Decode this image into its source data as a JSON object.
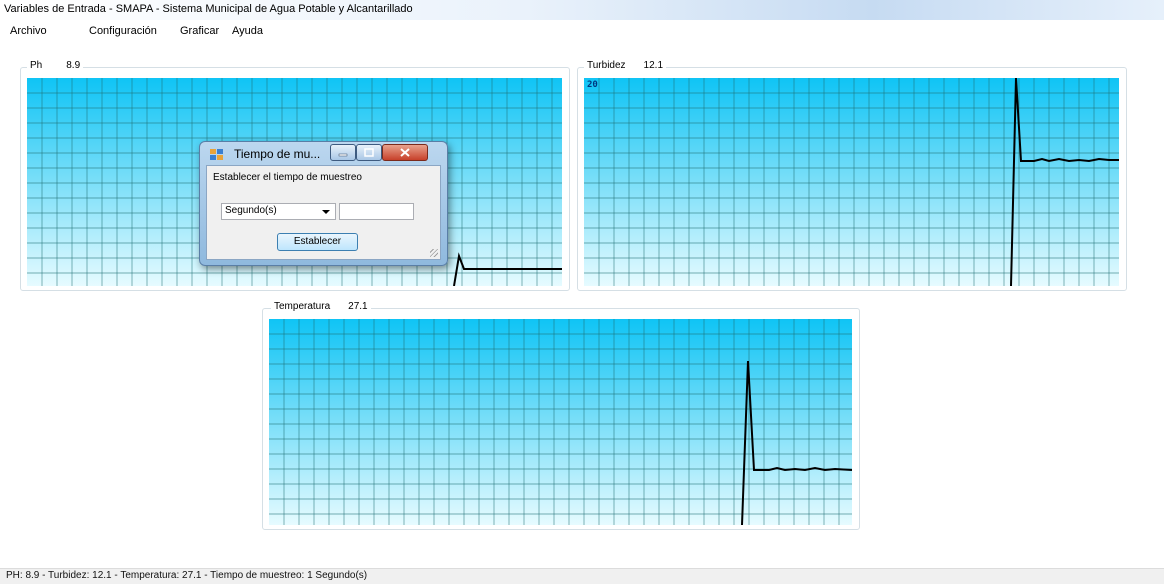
{
  "window": {
    "title": "Variables de Entrada - SMAPA - Sistema Municipal de Agua Potable y Alcantarillado"
  },
  "menu": [
    "Archivo",
    "Configuración",
    "Graficar",
    "Ayuda"
  ],
  "panels": {
    "ph": {
      "label": "Ph",
      "value": "8.9"
    },
    "turbidez": {
      "label": "Turbidez",
      "value": "12.1",
      "scale_label": "20"
    },
    "temperatura": {
      "label": "Temperatura",
      "value": "27.1"
    }
  },
  "dialog": {
    "title": "Tiempo de mu...",
    "message": "Establecer el tiempo de muestreo",
    "unit_selected": "Segundo(s)",
    "value_input": "",
    "button_label": "Establecer"
  },
  "statusbar": {
    "text": "PH:  8.9   - Turbidez:  12.1   - Temperatura:  27.1   - Tiempo de muestreo:  1 Segundo(s)"
  },
  "colors": {
    "plot_top": "#0fc4f5",
    "plot_bottom": "#e6fbff",
    "grid": "#1f6f73",
    "trace": "#000000"
  }
}
